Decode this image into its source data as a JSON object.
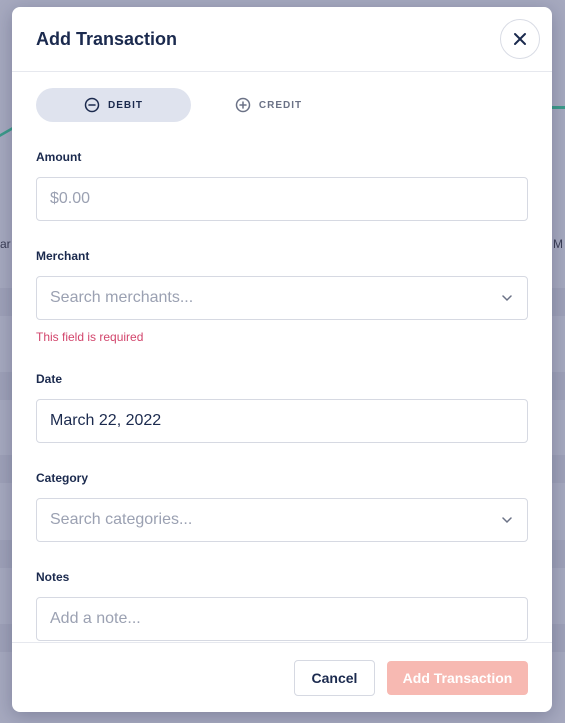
{
  "backdrop": {
    "axis_left": "ar",
    "axis_right": "M"
  },
  "modal": {
    "title": "Add Transaction",
    "type_toggle": {
      "debit_label": "DEBIT",
      "credit_label": "CREDIT",
      "selected": "DEBIT"
    },
    "fields": {
      "amount": {
        "label": "Amount",
        "placeholder": "$0.00",
        "value": ""
      },
      "merchant": {
        "label": "Merchant",
        "placeholder": "Search merchants...",
        "error": "This field is required"
      },
      "date": {
        "label": "Date",
        "value": "March 22, 2022"
      },
      "category": {
        "label": "Category",
        "placeholder": "Search categories..."
      },
      "notes": {
        "label": "Notes",
        "placeholder": "Add a note..."
      }
    },
    "footer": {
      "cancel_label": "Cancel",
      "submit_label": "Add Transaction"
    }
  },
  "colors": {
    "accent_text": "#1b2a4e",
    "error": "#d2456c",
    "submit_disabled": "#f7b9b2",
    "toggle_active": "#dfe3ee"
  }
}
